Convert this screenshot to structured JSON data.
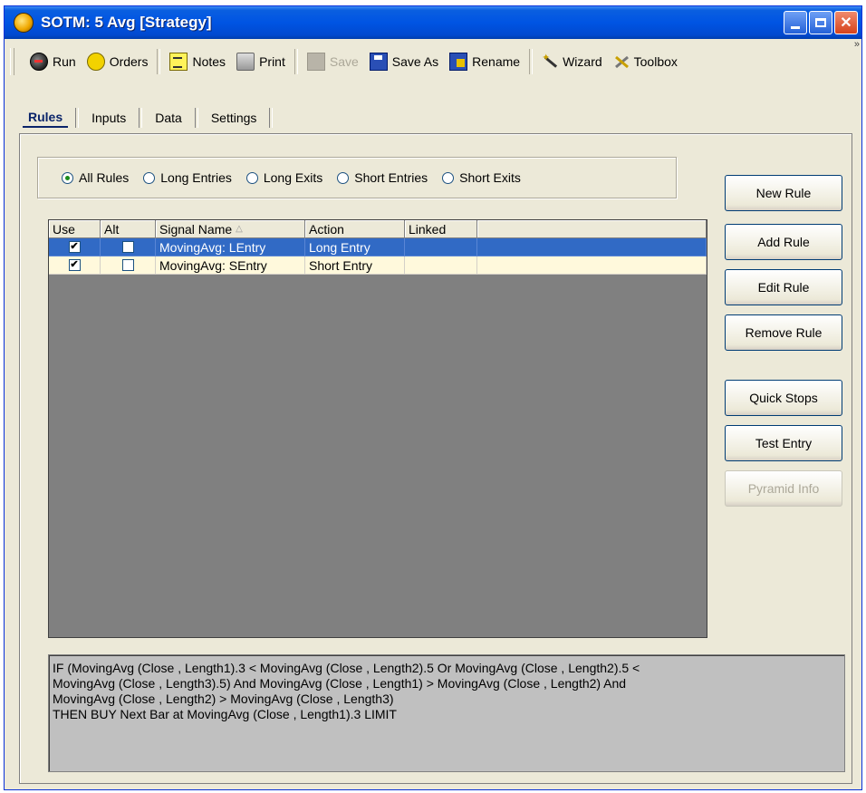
{
  "window": {
    "title": "SOTM: 5 Avg  [Strategy]"
  },
  "toolbar": {
    "items": [
      {
        "label": "Run",
        "icon": "run-icon"
      },
      {
        "label": "Orders",
        "icon": "orders-icon"
      },
      {
        "label": "Notes",
        "icon": "notes-icon"
      },
      {
        "label": "Print",
        "icon": "print-icon"
      },
      {
        "label": "Save",
        "icon": "save-icon",
        "disabled": true
      },
      {
        "label": "Save As",
        "icon": "save-as-icon"
      },
      {
        "label": "Rename",
        "icon": "rename-icon"
      },
      {
        "label": "Wizard",
        "icon": "wizard-icon"
      },
      {
        "label": "Toolbox",
        "icon": "toolbox-icon"
      }
    ],
    "overflow": "»"
  },
  "tabs": [
    {
      "label": "Rules",
      "active": true
    },
    {
      "label": "Inputs"
    },
    {
      "label": "Data"
    },
    {
      "label": "Settings"
    }
  ],
  "filter": {
    "options": [
      "All Rules",
      "Long Entries",
      "Long Exits",
      "Short Entries",
      "Short Exits"
    ],
    "selected": "All Rules"
  },
  "grid": {
    "columns": [
      "Use",
      "Alt",
      "Signal Name",
      "Action",
      "Linked"
    ],
    "rows": [
      {
        "use": true,
        "alt": false,
        "signal": "MovingAvg: LEntry",
        "action": "Long Entry",
        "linked": "",
        "selected": true
      },
      {
        "use": true,
        "alt": false,
        "signal": "MovingAvg: SEntry",
        "action": "Short Entry",
        "linked": "",
        "selected": false
      }
    ]
  },
  "buttons": {
    "new_rule": "New Rule",
    "add_rule": "Add Rule",
    "edit_rule": "Edit Rule",
    "remove_rule": "Remove Rule",
    "quick_stops": "Quick Stops",
    "test_entry": "Test Entry",
    "pyramid_info": "Pyramid Info"
  },
  "rule_text": {
    "lines": [
      "IF (MovingAvg (Close , Length1).3 < MovingAvg (Close , Length2).5 Or MovingAvg (Close , Length2).5 <",
      "MovingAvg (Close , Length3).5) And MovingAvg (Close , Length1) > MovingAvg (Close , Length2) And",
      "MovingAvg (Close , Length2) > MovingAvg (Close , Length3)",
      "THEN  BUY Next Bar at  MovingAvg (Close , Length1).3   LIMIT"
    ]
  }
}
